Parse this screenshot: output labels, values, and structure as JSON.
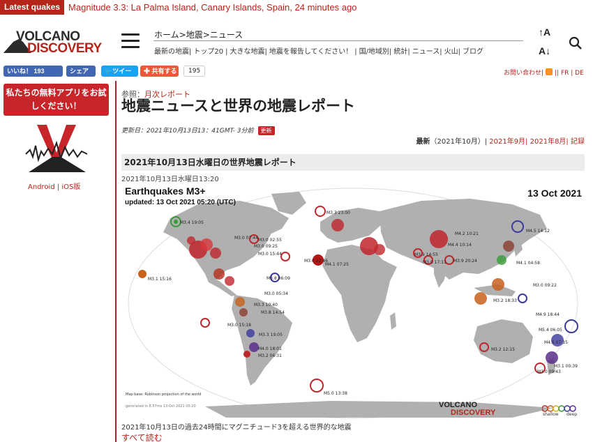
{
  "ticker": {
    "tag": "Latest quakes",
    "message": "Magnitude 3.3: La Palma Island, Canary Islands, Spain, 24 minutes ago"
  },
  "logo": {
    "line1": "VOLCANO",
    "line2": "DISCOVERY"
  },
  "header": {
    "breadcrumb": "ホーム>地震>ニュース",
    "nav": [
      "最新の地震|",
      "トップ20",
      "|",
      "大きな地震|",
      "地震を報告してください！",
      "|",
      "国/地域別|",
      "統計|",
      "ニュース|",
      "火山|",
      "ブログ"
    ],
    "font_up": "A",
    "font_down": "A"
  },
  "share": {
    "like_label": "いいね！ 193",
    "share_label": "シェア",
    "tweet_label": "ツイー",
    "plus_label": "共有する",
    "count": "195",
    "util_links": "お問い合わせ|",
    "langs": "|| FR | DE"
  },
  "sidebar": {
    "app_button": "私たちの無料アプリをお試しください！",
    "android": "Android",
    "sep": " | ",
    "ios": "iOS版"
  },
  "main": {
    "see_also_label": "参照：",
    "see_also_link": "月次レポート",
    "title": "地震ニュースと世界の地震レポート",
    "updated": "更新日：2021年10月13日13：41GMT- 3分前",
    "new_badge": "更新",
    "archive_latest": "最新",
    "archive_latest_paren": "（2021年10月）|",
    "archive_sep": "2021年9月|",
    "archive_prev2": "2021年8月|",
    "archive_record": "記録",
    "report_heading": "2021年10月13日水曜日の世界地震レポート",
    "report_date": "2021年10月13日水曜日13:20",
    "caption": "2021年10月13日の過去24時間にマグニチュード3を超える世界的な地震",
    "read_more": "すべて読む"
  },
  "map": {
    "title": "Earthquakes M3+",
    "subtitle": "updated: 13 Oct 2021 05:20 (UTC)",
    "date": "13 Oct 2021",
    "base": "Map base: Robinson projection of the world",
    "generated": "generated in 8.57ms 13 Oct 2021 05:20",
    "logo1": "VOLCANO",
    "logo2": "DISCOVERY",
    "legend_shallow": "shallow",
    "legend_deep": "deep",
    "labels": [
      "M3.4 19:05",
      "M3.0 07:44",
      "M3.0 02:55",
      "M3.0 09:25",
      "M3.0 15:44",
      "M3.1 15:16",
      "M3.3 23:00",
      "M4.2 10:21",
      "M4.4 10:14",
      "M4.5 14:12",
      "M4.1 07:25",
      "M3.0 22:46",
      "M3.9 14:55",
      "M3.0 17:11",
      "M3.9 20:24",
      "M3.0 09:22",
      "M4.1 04:58",
      "M3.0 05:34",
      "M3.3 10:40",
      "M3.8 14:54",
      "M3.0 15:18",
      "M3.3 19:05",
      "M4.0 18:01",
      "M3.2 06:31",
      "M4.9 18:44",
      "M3.2 12:15",
      "M5.4 06:05",
      "M4.5 07:15",
      "M3.1 00:39",
      "M3.0 09:43",
      "M5.0 13:38",
      "M3.8 06:09",
      "M3.2 18:33"
    ]
  },
  "colors": {
    "brand_red": "#b5251a",
    "facebook": "#4267b2",
    "twitter": "#1da1f2",
    "land": "#b0b0b0"
  }
}
